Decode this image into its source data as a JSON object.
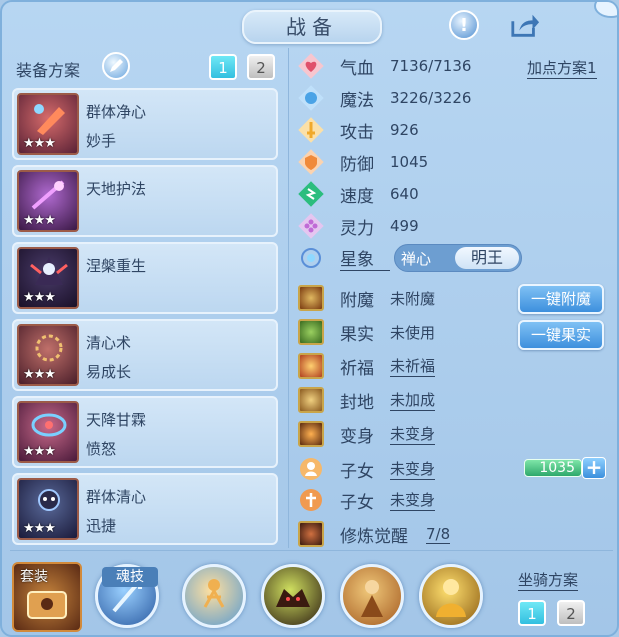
{
  "title": "战备",
  "left_panel": {
    "scheme_label": "装备方案",
    "scheme_tabs": [
      "1",
      "2"
    ],
    "skills": [
      {
        "name": "群体净心",
        "sub": "妙手",
        "stars": "★★★"
      },
      {
        "name": "天地护法",
        "sub": "",
        "stars": "★★★"
      },
      {
        "name": "涅槃重生",
        "sub": "",
        "stars": "★★★"
      },
      {
        "name": "清心术",
        "sub": "易成长",
        "stars": "★★★"
      },
      {
        "name": "天降甘霖",
        "sub": "愤怒",
        "stars": "★★★"
      },
      {
        "name": "群体清心",
        "sub": "迅捷",
        "stars": "★★★"
      }
    ]
  },
  "stats": {
    "add_points_label": "加点方案1",
    "items": [
      {
        "label": "气血",
        "value": "7136/7136",
        "icon": "heart-icon",
        "color": "#e0506a"
      },
      {
        "label": "魔法",
        "value": "3226/3226",
        "icon": "mana-icon",
        "color": "#4aa3e6"
      },
      {
        "label": "攻击",
        "value": "926",
        "icon": "sword-icon",
        "color": "#f0a92a"
      },
      {
        "label": "防御",
        "value": "1045",
        "icon": "shield-icon",
        "color": "#f08a3a"
      },
      {
        "label": "速度",
        "value": "640",
        "icon": "speed-icon",
        "color": "#2bbd7e"
      },
      {
        "label": "灵力",
        "value": "499",
        "icon": "spirit-icon",
        "color": "#c06ad6"
      }
    ],
    "constellation_label": "星象",
    "constellation_options": [
      "禅心",
      "明王"
    ],
    "constellation_selected": "明王"
  },
  "buffs": [
    {
      "label": "附魔",
      "value": "未附魔",
      "underline": false,
      "icon": "enchant-icon"
    },
    {
      "label": "果实",
      "value": "未使用",
      "underline": false,
      "icon": "fruit-icon"
    },
    {
      "label": "祈福",
      "value": "未祈福",
      "underline": true,
      "icon": "blessing-icon"
    },
    {
      "label": "封地",
      "value": "未加成",
      "underline": true,
      "icon": "fief-icon"
    },
    {
      "label": "变身",
      "value": "未变身",
      "underline": true,
      "icon": "transform-icon"
    },
    {
      "label": "子女",
      "value": "未变身",
      "underline": true,
      "icon": "child-icon"
    },
    {
      "label": "子女",
      "value": "未变身",
      "underline": true,
      "icon": "child2-icon"
    },
    {
      "label": "修炼觉醒",
      "value": "7/8",
      "underline": true,
      "icon": "cultivation-icon"
    }
  ],
  "buttons": {
    "enchant_all": "一键附魔",
    "fruit_all": "一键果实"
  },
  "jade_value": "1035",
  "bottom": {
    "suit_label": "套装",
    "soul_skill_label": "魂技",
    "mount_label": "坐骑方案",
    "mount_tabs": [
      "1",
      "2"
    ]
  },
  "colors": {
    "accent": "#33bfe0",
    "panel": "#b7d6f2",
    "text": "#2f4563"
  }
}
